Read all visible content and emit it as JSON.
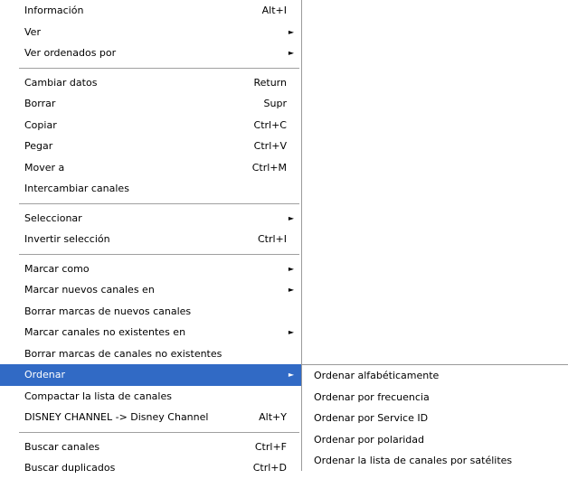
{
  "main_menu": {
    "group1": [
      {
        "label": "Información",
        "shortcut": "Alt+I"
      },
      {
        "label": "Ver",
        "shortcut": ""
      },
      {
        "label": "Ver ordenados por",
        "shortcut": ""
      }
    ],
    "group2": [
      {
        "label": "Cambiar datos",
        "shortcut": "Return"
      },
      {
        "label": "Borrar",
        "shortcut": "Supr"
      },
      {
        "label": "Copiar",
        "shortcut": "Ctrl+C"
      },
      {
        "label": "Pegar",
        "shortcut": "Ctrl+V"
      },
      {
        "label": "Mover a",
        "shortcut": "Ctrl+M"
      },
      {
        "label": "Intercambiar canales",
        "shortcut": ""
      }
    ],
    "group3": [
      {
        "label": "Seleccionar",
        "shortcut": ""
      },
      {
        "label": "Invertir selección",
        "shortcut": "Ctrl+I"
      }
    ],
    "group4": [
      {
        "label": "Marcar como",
        "shortcut": ""
      },
      {
        "label": "Marcar nuevos canales en",
        "shortcut": ""
      },
      {
        "label": "Borrar marcas de nuevos canales",
        "shortcut": ""
      },
      {
        "label": "Marcar canales no existentes en",
        "shortcut": ""
      },
      {
        "label": "Borrar marcas de canales no existentes",
        "shortcut": ""
      },
      {
        "label": "Ordenar",
        "shortcut": ""
      },
      {
        "label": "Compactar la lista de canales",
        "shortcut": ""
      },
      {
        "label": "DISNEY CHANNEL -> Disney Channel",
        "shortcut": "Alt+Y"
      }
    ],
    "group5": [
      {
        "label": "Buscar canales",
        "shortcut": "Ctrl+F"
      },
      {
        "label": "Buscar duplicados",
        "shortcut": "Ctrl+D"
      }
    ],
    "arrow_glyph": "►"
  },
  "sub_menu": {
    "items": [
      {
        "label": "Ordenar alfabéticamente"
      },
      {
        "label": "Ordenar por frecuencia"
      },
      {
        "label": "Ordenar por Service ID"
      },
      {
        "label": "Ordenar por polaridad"
      },
      {
        "label": "Ordenar la lista de canales por satélites"
      }
    ]
  },
  "colors": {
    "selected_bg": "#316ac5",
    "selected_fg": "#ffffff",
    "separator": "#a0a0a0"
  }
}
